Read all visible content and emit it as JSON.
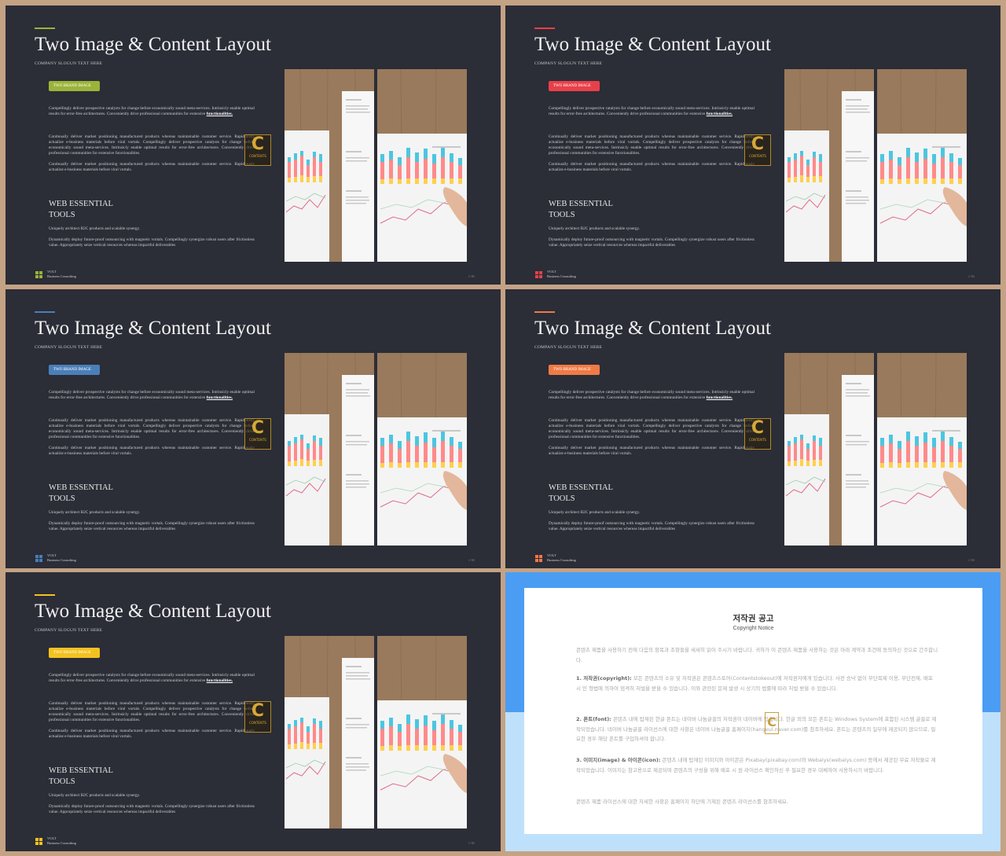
{
  "slides": [
    {
      "title": "Two Image & Content Layout",
      "slogan": "COMPANY SLOGUN TEXT HERE",
      "badge": "TWO BRAND IMAGE",
      "accent": "#9cb33a"
    },
    {
      "title": "Two Image & Content Layout",
      "slogan": "COMPANY SLOGUN TEXT HERE",
      "badge": "TWO BRAND IMAGE",
      "accent": "#e8404a"
    },
    {
      "title": "Two Image & Content Layout",
      "slogan": "COMPANY SLOGUN TEXT HERE",
      "badge": "TWO BRAND IMAGE",
      "accent": "#4a7fb8"
    },
    {
      "title": "Two Image & Content Layout",
      "slogan": "COMPANY SLOGUN TEXT HERE",
      "badge": "TWO BRAND IMAGE",
      "accent": "#f07a45"
    },
    {
      "title": "Two Image & Content Layout",
      "slogan": "COMPANY SLOGUN TEXT HERE",
      "badge": "TWO BRAND IMAGE",
      "accent": "#f4c21f"
    }
  ],
  "content": {
    "p1": "Compellingly deliver prospective catalysts for change before economically sound meta-services. Intrinsicly enable optimal results for error-free architectures. Conveniently drive professional communities for extensive",
    "p1_bold": "functionalities.",
    "p2": "Continually deliver market positioning manufactured products whereas maintainable customer service. Rapidiously actualize e-business materials before viral vortals. Compellingly deliver prospective catalysts for change before economically sound meta-services. Intrinsicly enable optimal results for error-free architectures. Conveniently drive professional communities for extensive functionalities.",
    "p3": "Continually deliver market positioning manufactured products whereas maintainable customer service. Rapidiously actualize e-business materials before viral vortals.",
    "web_line1": "WEB ESSENTIAL",
    "web_line2": "TOOLS",
    "p4": "Uniquely architect B2C products and scalable synergy.",
    "p5": "Dynamically deploy future-proof outsourcing with magnetic vortals. Compellingly synergize robust users after frictionless value. Appropriately seize vertical resources whereas impactful deliverables",
    "brand": "VOLT",
    "brand_sub": "Business  Consulting",
    "page_no": "// 01",
    "watermark_letter": "C",
    "watermark_text": "CONTENTS"
  },
  "colors": {
    "background": "#c4a284",
    "slide_bg": "#2b2d37",
    "notice_blue": "#4a9df3",
    "notice_light": "#bfe0fb"
  },
  "notice": {
    "title": "저작권 공고",
    "subtitle": "Copyright Notice",
    "p1": "콘텐츠 제품을 사용하기 전에 다음의 항목과 조항들을 세세히 읽어 주시기 바랍니다. 귀하가 이 콘텐츠 제품을 사용하는 것은 아래 계약과 조건에 동의하신 것으로 간주합니다.",
    "p2_bold": "1. 저작권(copyright):",
    "p2": " 모든 콘텐츠의 소유 및 저작권은 콘텐츠스토어(Contentstokeout)에 저작권자에게 있습니다. 사전 승낙 없이 무단복제 이용, 무단전재, 배포 시 민 형법에 의하여 엄격히 처벌을 받을 수 있습니다. 이와 관련된 문제 발생 시 상기의 법률에 따라 처벌 받을 수 있습니다.",
    "p3_bold": "2. 폰트(font):",
    "p3": " 콘텐츠 내에 탑재된 한글 폰트는 네이버 나눔글꼴의 저작권이 네이버에 있습니다. 한글 외의 모든 폰트는 Windows System에 포함된 시스템 글꼴로 제작되었습니다. 네이버 나눔글꼴 라이선스에 대한 사항은 네이버 나눔글꼴 홈페이지(hangeul.naver.com)를 참조하세요. 폰트는 콘텐츠의 일부에 제공되지 않으므로, 필요한 경우 해당 폰트를 구입하셔야 합니다.",
    "p4_bold": "3. 이미지(image) & 아이콘(icon):",
    "p4": " 콘텐츠 내에 탑재된 이미지와 아이콘은 Pixabay(pixabay.com)와 Webalys(webalys.com) 등에서 제공된 무료 저작물로 제작되었습니다. 이미지는 참고용으로 제공되며 콘텐츠의 구성을 위해 배포 시 원 라이선스 확인하신 후 필요한 경우 대체하여 사용하시기 바랍니다.",
    "p5": "콘텐츠 제품 라이선스에 대한 자세한 사항은 홈페이지 하단에 기재된 콘텐츠 라이선스를 참조하세요."
  }
}
